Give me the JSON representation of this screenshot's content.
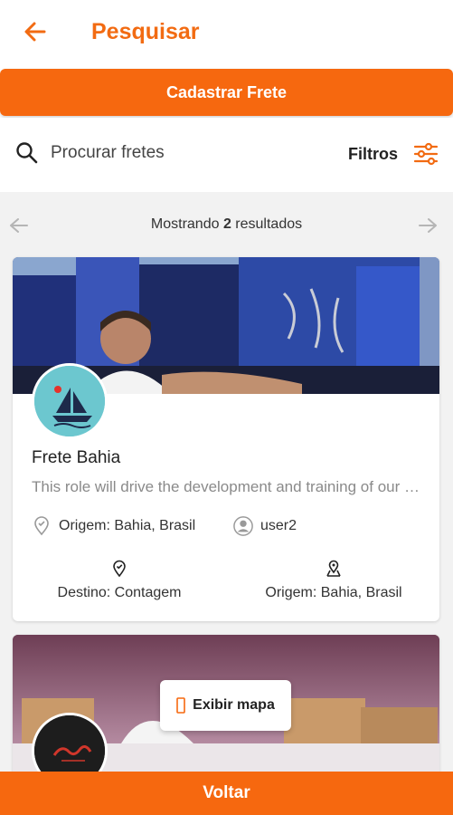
{
  "appbar": {
    "title": "Pesquisar",
    "back_icon": "arrow-left-icon"
  },
  "actions": {
    "register_label": "Cadastrar Frete"
  },
  "search": {
    "placeholder": "Procurar fretes",
    "filters_label": "Filtros"
  },
  "pager": {
    "prefix": "Mostrando ",
    "count": "2",
    "suffix": " resultados"
  },
  "results": [
    {
      "title": "Frete Bahia",
      "description": "This role will drive the development and training of our team",
      "origin_label": "Origem: Bahia, Brasil",
      "user": "user2",
      "destination": "Destino: Contagem",
      "origin": "Origem: Bahia, Brasil"
    },
    {
      "title": "",
      "description": ""
    }
  ],
  "map_button": {
    "label": "Exibir mapa"
  },
  "footer": {
    "back_label": "Voltar"
  },
  "colors": {
    "accent": "#f6680f",
    "title": "#f26b12",
    "background": "#f2f2f2"
  }
}
